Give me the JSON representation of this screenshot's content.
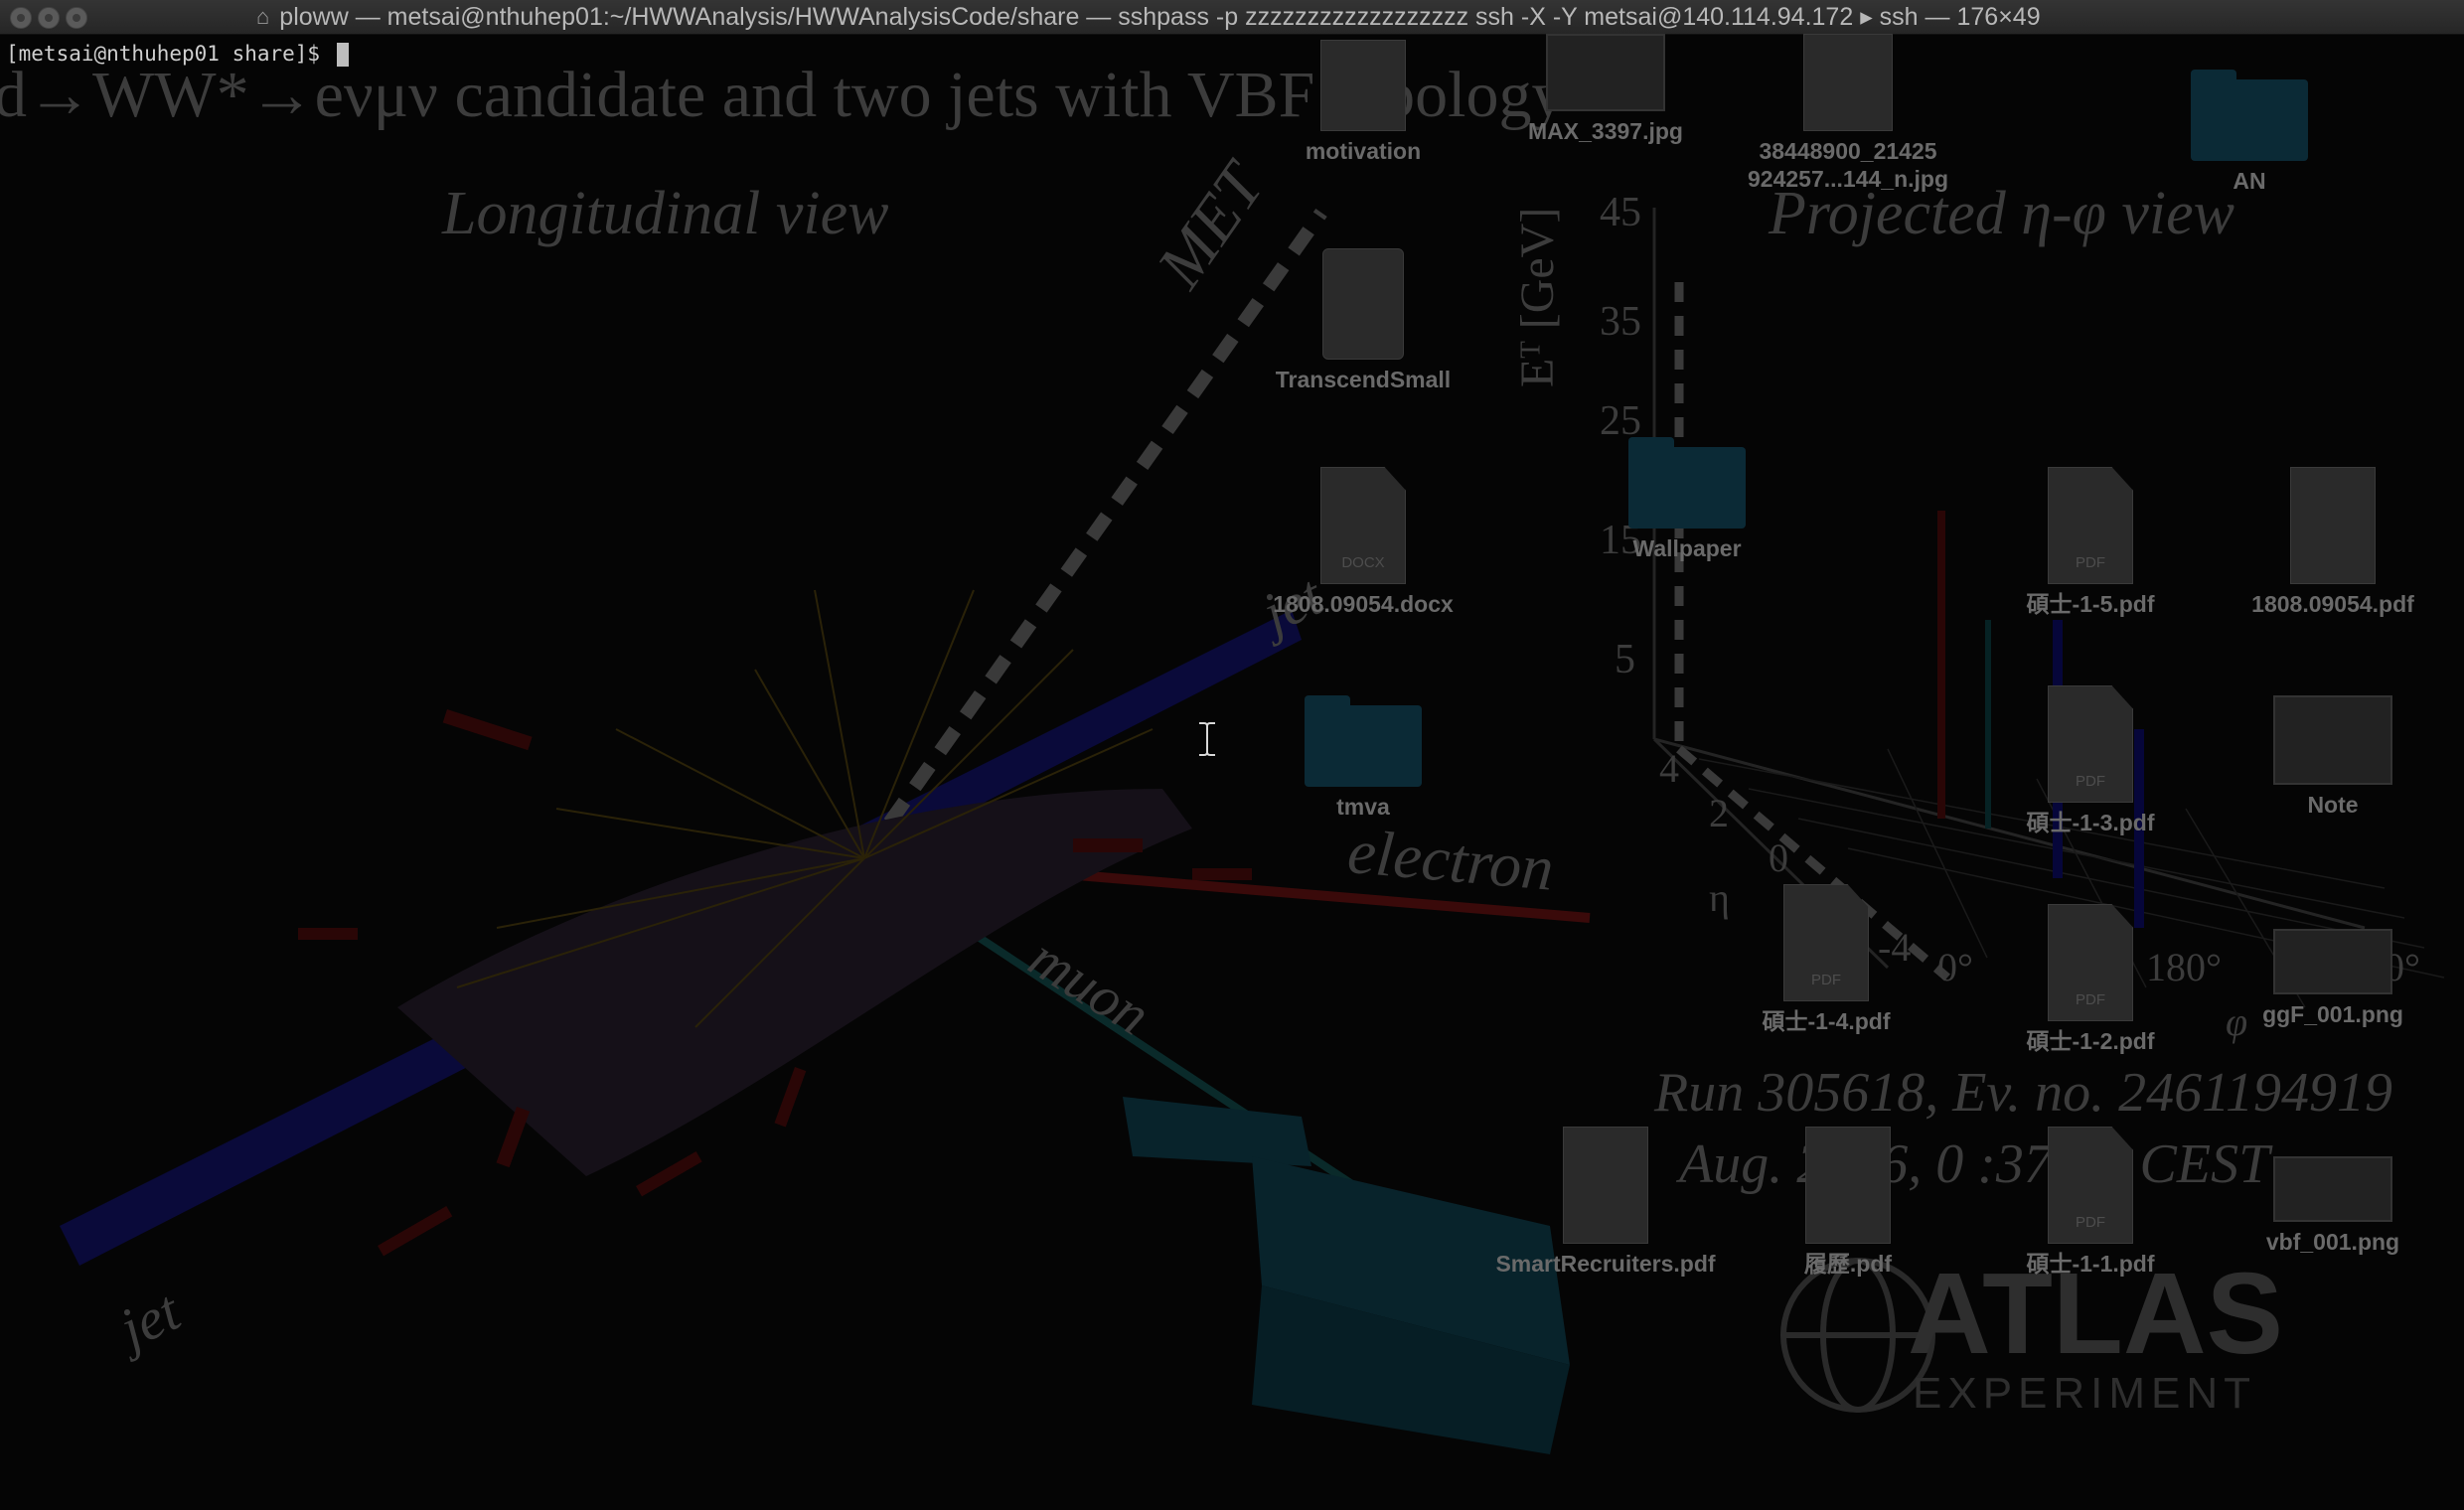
{
  "window": {
    "title": "ploww — metsai@nthuhep01:~/HWWAnalysis/HWWAnalysisCode/share — sshpass -p zzzzzzzzzzzzzzzzzz ssh -X -Y metsai@140.114.94.172 ▸ ssh — 176×49"
  },
  "terminal": {
    "prompt": "[metsai@nthuhep01 share]$ "
  },
  "background": {
    "headline": "d→WW*→eνμν candidate and two jets with VBF topology",
    "longitudinal": "Longitudinal view",
    "projected": "Projected  η-φ view",
    "met": "MET",
    "jet_upper": "jet",
    "jet_lower": "jet",
    "electron": "electron",
    "muon": "muon",
    "et_axis": "Eᵀ [GeV]",
    "et_ticks": [
      "45",
      "35",
      "25",
      "15",
      "5"
    ],
    "eta_label": "η",
    "eta_ticks": [
      "4",
      "2",
      "0",
      "-4"
    ],
    "phi_label": "φ",
    "phi_ticks": [
      "0°",
      "9",
      "180°",
      "360°"
    ],
    "run": "Run 305618, Ev. no. 2461194919",
    "date": "Aug. 2016, 0 :37:53 CEST",
    "atlas": "ATLAS",
    "experiment": "EXPERIMENT"
  },
  "desktop_icons": [
    {
      "label": "motivation",
      "kind": "doc"
    },
    {
      "label": "MAX_3397.jpg",
      "kind": "image"
    },
    {
      "label": "38448900_21425 924257...144_n.jpg",
      "kind": "doc"
    },
    {
      "label": "AN",
      "kind": "folder"
    },
    {
      "label": "TranscendSmall",
      "kind": "drive"
    },
    {
      "label": "1808.09054.docx",
      "kind": "docx"
    },
    {
      "label": "Wallpaper",
      "kind": "folder"
    },
    {
      "label": "碩士-1-5.pdf",
      "kind": "pdf"
    },
    {
      "label": "1808.09054.pdf",
      "kind": "doc"
    },
    {
      "label": "tmva",
      "kind": "folder"
    },
    {
      "label": "碩士-1-3.pdf",
      "kind": "pdf"
    },
    {
      "label": "Note",
      "kind": "image"
    },
    {
      "label": "碩士-1-4.pdf",
      "kind": "pdf"
    },
    {
      "label": "碩士-1-2.pdf",
      "kind": "pdf"
    },
    {
      "label": "ggF_001.png",
      "kind": "image"
    },
    {
      "label": "SmartRecruiters.pdf",
      "kind": "doc"
    },
    {
      "label": "履歷.pdf",
      "kind": "doc"
    },
    {
      "label": "碩士-1-1.pdf",
      "kind": "pdf"
    },
    {
      "label": "vbf_001.png",
      "kind": "image"
    }
  ],
  "icon_tags": {
    "docx": "DOCX",
    "pdf": "PDF"
  },
  "icons": [
    "close-light-icon",
    "minimize-light-icon",
    "zoom-light-icon",
    "home-icon",
    "text-cursor-icon"
  ]
}
